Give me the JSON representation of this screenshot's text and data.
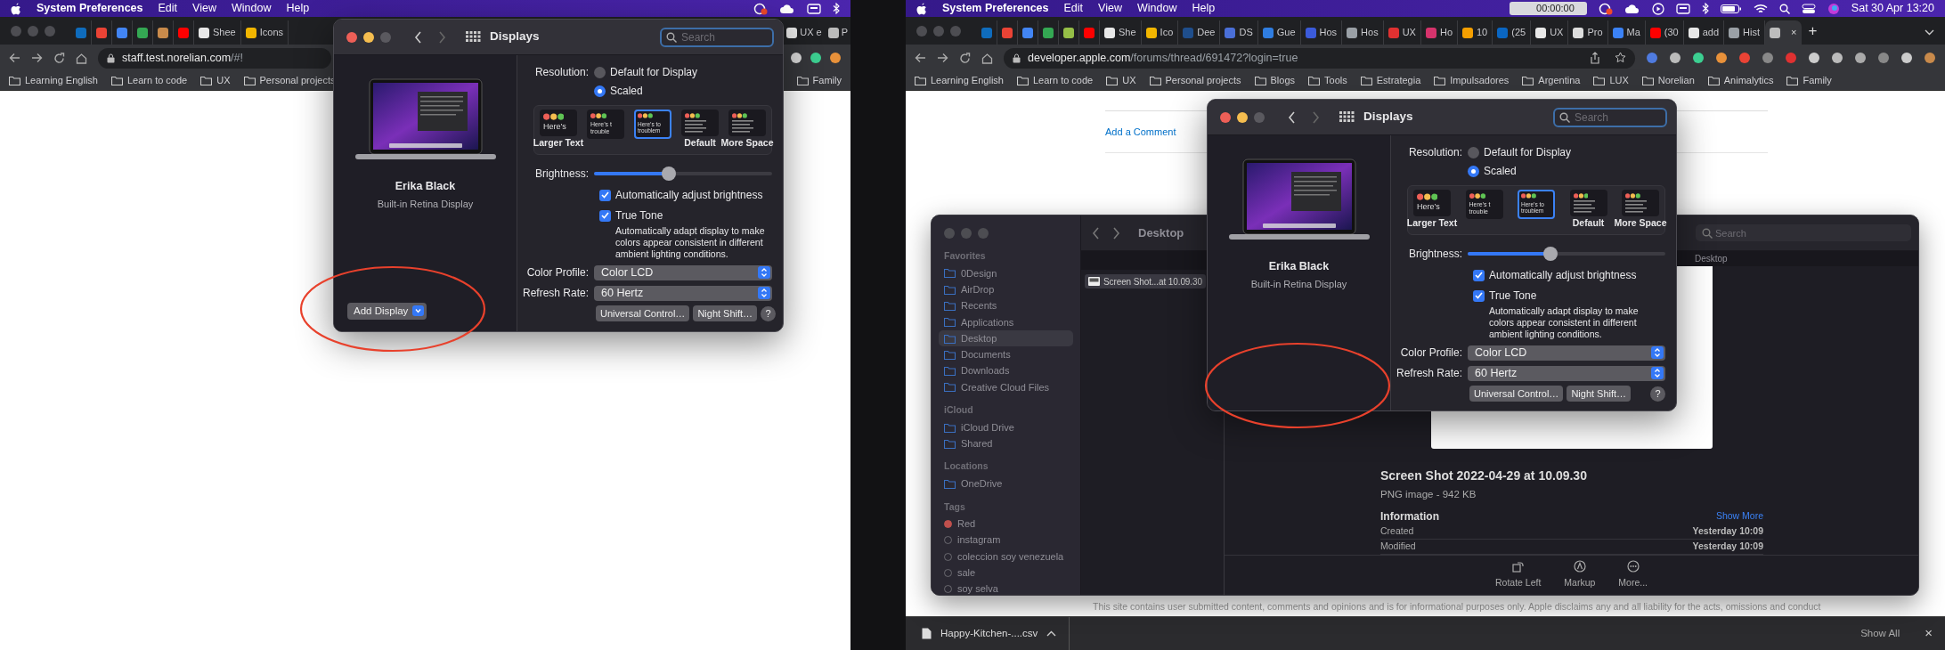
{
  "screens": [
    {
      "menu_bar": {
        "app": "System Preferences",
        "items": [
          "Edit",
          "View",
          "Window",
          "Help"
        ]
      },
      "browser": {
        "tabs": [
          {
            "color": "#0f6cbd",
            "selected": false
          },
          {
            "color": "#ea4335",
            "selected": false
          },
          {
            "color": "#4285f4",
            "selected": false
          },
          {
            "color": "#34a853",
            "selected": false
          },
          {
            "color": "#c98a4b",
            "selected": false
          },
          {
            "color": "#ff0000",
            "selected": false
          },
          {
            "label": "Shee",
            "color": "#e8e8e8",
            "selected": false
          },
          {
            "label": "Icons",
            "color": "#f2b600",
            "selected": false
          }
        ],
        "tabs_after_window": [
          {
            "label": "UX e",
            "color": "#e8e8e8",
            "selected": false
          },
          {
            "label": "P",
            "color": "#bbbbbb",
            "selected": false
          }
        ],
        "url": {
          "host": "staff.test.norelian.com",
          "path": "/#!"
        },
        "bookmarks": [
          "Learning English",
          "Learn to code",
          "UX",
          "Personal projects"
        ],
        "bookmarks_end": [
          "Family"
        ]
      },
      "displays": {
        "title": "Displays",
        "search_placeholder": "Search",
        "display_name": "Erika Black",
        "display_type": "Built-in Retina Display",
        "resolution": {
          "label": "Resolution:",
          "options": [
            {
              "label": "Default for Display",
              "selected": false
            },
            {
              "label": "Scaled",
              "selected": true
            }
          ]
        },
        "scales": [
          {
            "label": "Larger Text",
            "sample_lines": [
              "Here’s"
            ],
            "selected": false
          },
          {
            "sample_lines": [
              "Here’s t",
              "trouble"
            ],
            "selected": false
          },
          {
            "sample_lines": [
              "Here’s to",
              "troublem"
            ],
            "selected": true
          },
          {
            "label": "Default",
            "selected": false
          },
          {
            "label": "More Space",
            "selected": false
          }
        ],
        "brightness": {
          "label": "Brightness:",
          "level": 0.42
        },
        "checks": [
          {
            "label": "Automatically adjust brightness",
            "checked": true
          },
          {
            "label": "True Tone",
            "checked": true,
            "description": "Automatically adapt display to make colors appear consistent in different ambient lighting conditions."
          }
        ],
        "selects": [
          {
            "label": "Color Profile:",
            "value": "Color LCD"
          },
          {
            "label": "Refresh Rate:",
            "value": "60 Hertz"
          }
        ],
        "buttons": [
          "Universal Control…",
          "Night Shift…"
        ],
        "help": "?",
        "add_display": "Add Display"
      }
    },
    {
      "menu_bar": {
        "app": "System Preferences",
        "items": [
          "Edit",
          "View",
          "Window",
          "Help"
        ],
        "timer": "00:00:00",
        "clock": "Sat 30 Apr  13:20"
      },
      "browser": {
        "tabs": [
          {
            "color": "#0f6cbd",
            "selected": false
          },
          {
            "color": "#ea4335",
            "selected": false
          },
          {
            "color": "#4285f4",
            "selected": false
          },
          {
            "color": "#34a853",
            "selected": false
          },
          {
            "color": "#95bf47",
            "selected": false
          },
          {
            "color": "#ff0000",
            "selected": false
          },
          {
            "label": "She",
            "color": "#e8e8e8",
            "selected": false
          },
          {
            "label": "Ico",
            "color": "#f2b600",
            "selected": false
          },
          {
            "label": "Dee",
            "color": "#1f4e8c",
            "selected": false
          },
          {
            "label": "DS",
            "color": "#4a6fd8",
            "selected": false
          },
          {
            "label": "Gue",
            "color": "#2f7de1",
            "selected": false
          },
          {
            "label": "Hos",
            "color": "#3b5bdb",
            "selected": false
          },
          {
            "label": "Hos",
            "color": "#9aa0a6",
            "selected": false
          },
          {
            "label": "UX",
            "color": "#e03131",
            "selected": false
          },
          {
            "label": "Ho",
            "color": "#d6336c",
            "selected": false
          },
          {
            "label": "10",
            "color": "#f59f00",
            "selected": false
          },
          {
            "label": "(25",
            "color": "#0a66c2",
            "selected": false
          },
          {
            "label": "UX",
            "color": "#e8e8e8",
            "selected": false
          },
          {
            "label": "Pro",
            "color": "#dddddd",
            "selected": false
          },
          {
            "label": "Ma",
            "color": "#3b82f6",
            "selected": false
          },
          {
            "label": "(30",
            "color": "#ff0000",
            "selected": false
          },
          {
            "label": "add",
            "color": "#e8e8e8",
            "selected": false
          },
          {
            "label": "Hist",
            "color": "#9aa0a6",
            "selected": false
          },
          {
            "color": "#bdbdbd",
            "selected": true,
            "close": "×"
          }
        ],
        "new_tab": "+",
        "url": {
          "host": "developer.apple.com",
          "path": "/forums/thread/691472?login=true"
        },
        "bookmarks": [
          "Learning English",
          "Learn to code",
          "UX",
          "Personal projects",
          "Blogs",
          "Tools",
          "Estrategia",
          "Impulsadores",
          "Argentina",
          "LUX",
          "Norelian",
          "Animalytics",
          "Family"
        ]
      },
      "page": {
        "comment_link": "Add a Comment",
        "footer": "This site contains user submitted content, comments and opinions and is for informational purposes only. Apple disclaims any and all liability for the acts, omissions and conduct"
      },
      "finder": {
        "title": "Desktop",
        "search_placeholder": "Search",
        "sidebar": [
          {
            "heading": "Favorites",
            "kind": "places",
            "items": [
              {
                "label": "0Design",
                "selected": false
              },
              {
                "label": "AirDrop",
                "selected": false
              },
              {
                "label": "Recents",
                "selected": false
              },
              {
                "label": "Applications",
                "selected": false
              },
              {
                "label": "Desktop",
                "selected": true
              },
              {
                "label": "Documents",
                "selected": false
              },
              {
                "label": "Downloads",
                "selected": false
              },
              {
                "label": "Creative Cloud Files",
                "selected": false
              }
            ]
          },
          {
            "heading": "iCloud",
            "kind": "places",
            "items": [
              {
                "label": "iCloud Drive",
                "selected": false
              },
              {
                "label": "Shared",
                "selected": false
              }
            ]
          },
          {
            "heading": "Locations",
            "kind": "places",
            "items": [
              {
                "label": "OneDrive",
                "selected": false
              }
            ]
          },
          {
            "heading": "Tags",
            "kind": "tags",
            "items": [
              {
                "label": "Red",
                "color": "#c0504d"
              },
              {
                "label": "instagram"
              },
              {
                "label": "coleccion soy venezuela"
              },
              {
                "label": "sale"
              },
              {
                "label": "soy selva"
              }
            ]
          }
        ],
        "files": [
          {
            "label": "Screen Shot...at 10.09.30",
            "selected": true
          }
        ],
        "preview_header": "Desktop",
        "file_title": "Screen Shot 2022-04-29 at 10.09.30",
        "file_kind": "PNG image - 942 KB",
        "info_heading": "Information",
        "show_more": "Show More",
        "info": [
          {
            "label": "Created",
            "value": "Yesterday 10:09"
          },
          {
            "label": "Modified",
            "value": "Yesterday 10:09"
          }
        ],
        "actions": [
          "Rotate Left",
          "Markup",
          "More..."
        ]
      },
      "displays": {
        "title": "Displays",
        "search_placeholder": "Search",
        "display_name": "Erika Black",
        "display_type": "Built-in Retina Display",
        "resolution": {
          "label": "Resolution:",
          "options": [
            {
              "label": "Default for Display",
              "selected": false
            },
            {
              "label": "Scaled",
              "selected": true
            }
          ]
        },
        "scales": [
          {
            "label": "Larger Text",
            "sample_lines": [
              "Here’s"
            ],
            "selected": false
          },
          {
            "sample_lines": [
              "Here’s t",
              "trouble"
            ],
            "selected": false
          },
          {
            "sample_lines": [
              "Here’s to",
              "troublem"
            ],
            "selected": true
          },
          {
            "label": "Default",
            "selected": false
          },
          {
            "label": "More Space",
            "selected": false
          }
        ],
        "brightness": {
          "label": "Brightness:",
          "level": 0.42
        },
        "checks": [
          {
            "label": "Automatically adjust brightness",
            "checked": true
          },
          {
            "label": "True Tone",
            "checked": true,
            "description": "Automatically adapt display to make colors appear consistent in different ambient lighting conditions."
          }
        ],
        "selects": [
          {
            "label": "Color Profile:",
            "value": "Color LCD"
          },
          {
            "label": "Refresh Rate:",
            "value": "60 Hertz"
          }
        ],
        "buttons": [
          "Universal Control…",
          "Night Shift…"
        ],
        "help": "?"
      },
      "download": {
        "file": "Happy-Kitchen-....csv",
        "show_all": "Show All",
        "close": "×"
      }
    }
  ]
}
